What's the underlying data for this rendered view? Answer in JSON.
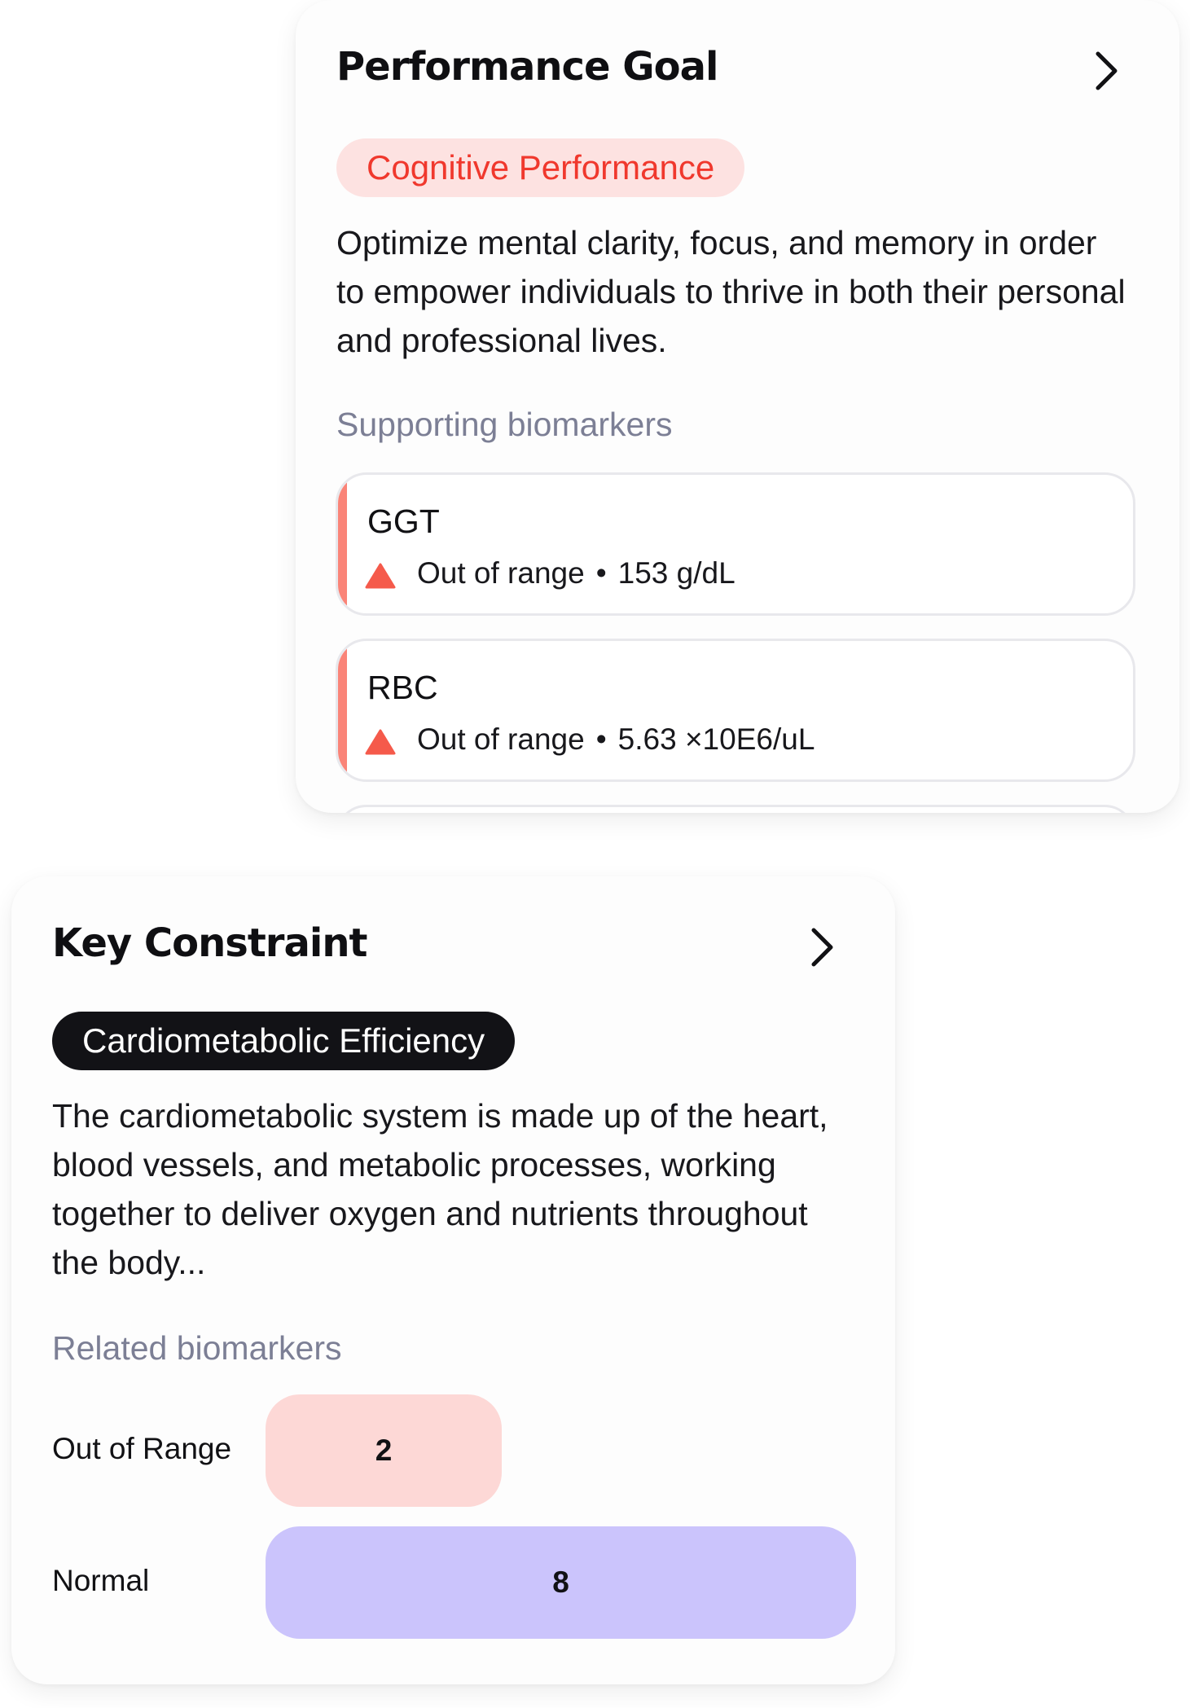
{
  "goal": {
    "title": "Performance Goal",
    "category": "Cognitive Performance",
    "description": "Optimize mental clarity, focus, and memory in order to empower individuals to thrive in both their personal and professional lives.",
    "biomarkers_label": "Supporting biomarkers",
    "biomarkers": [
      {
        "name": "GGT",
        "status": "Out of range",
        "value": "153 g/dL"
      },
      {
        "name": "RBC",
        "status": "Out of range",
        "value": "5.63 ×10E6/uL"
      }
    ]
  },
  "constraint": {
    "title": "Key Constraint",
    "category": "Cardiometabolic Efficiency",
    "description": "The cardiometabolic system is made up of the heart, blood vessels, and metabolic processes, working together to deliver oxygen and nutrients throughout the body...",
    "biomarkers_label": "Related biomarkers",
    "counts": [
      {
        "label": "Out of Range",
        "value": "2"
      },
      {
        "label": "Normal",
        "value": "8"
      }
    ]
  },
  "separator": "•",
  "colors": {
    "goal_pill_bg": "#fde2e1",
    "goal_pill_text": "#f0382d",
    "warning": "#f55a4b",
    "accent_bar": "#fa8478",
    "out_of_range_bar": "#fdd8d6",
    "normal_bar": "#cbc4fc",
    "muted_label": "#7c7f95"
  },
  "icons": {
    "chevron": "chevron-right-icon",
    "warning": "warning-triangle-icon"
  }
}
